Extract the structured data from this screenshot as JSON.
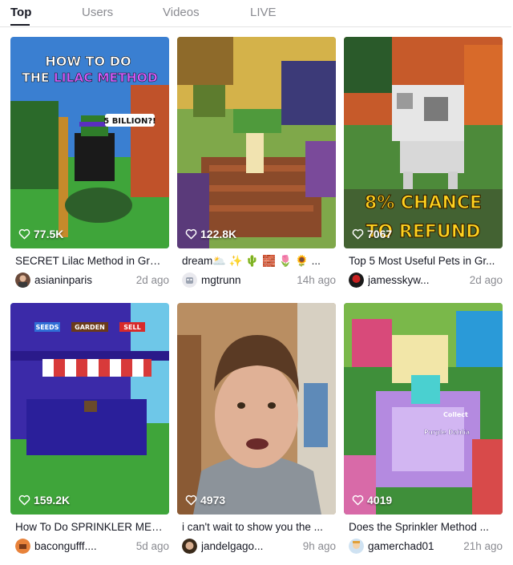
{
  "tabs": [
    {
      "label": "Top",
      "active": true
    },
    {
      "label": "Users",
      "active": false
    },
    {
      "label": "Videos",
      "active": false
    },
    {
      "label": "LIVE",
      "active": false
    }
  ],
  "videos": [
    {
      "likes": "77.5K",
      "title": "SECRET Lilac Method in Gro...",
      "author": "asianinparis",
      "age": "2d ago",
      "overlay": {
        "line1": "HOW TO DO",
        "line2_a": "THE ",
        "line2_b": "LILAC METHOD",
        "badge": "5 BILLION?!"
      }
    },
    {
      "likes": "122.8K",
      "title": "dream🌥️ ✨ 🌵 🧱 🌷 🌻 ...",
      "author": "mgtrunn",
      "age": "14h ago"
    },
    {
      "likes": "7067",
      "title": "Top 5 Most Useful Pets in Gr...",
      "author": "jamesskyw...",
      "age": "2d ago",
      "overlay": {
        "line1": "8% CHANCE",
        "line2": "TO REFUND"
      }
    },
    {
      "likes": "159.2K",
      "title": "How To Do SPRINKLER MET...",
      "author": "bacongufff....",
      "age": "5d ago",
      "overlay": {
        "seeds": "SEEDS",
        "garden": "GARDEN",
        "sell": "SELL"
      }
    },
    {
      "likes": "4973",
      "title": "i can't wait to show you the ...",
      "author": "jandelgago...",
      "age": "9h ago"
    },
    {
      "likes": "4019",
      "title": "Does the Sprinkler Method ...",
      "author": "gamerchad01",
      "age": "21h ago",
      "overlay": {
        "label1": "Collect",
        "label2": "Purple Dahlia"
      }
    }
  ],
  "colors": {
    "text_primary": "#161823",
    "text_secondary": "#8a8b91",
    "divider": "#e3e3e4",
    "lilac_accent": "#d45cff",
    "chance_yellow": "#ffd21f"
  },
  "icons": {
    "likes": "heart-outline-icon"
  }
}
